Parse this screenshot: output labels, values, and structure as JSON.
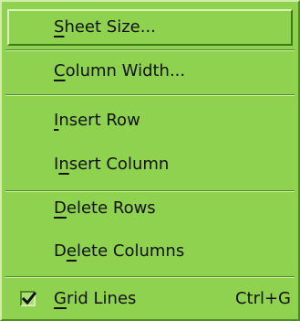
{
  "menu": {
    "items": [
      {
        "pre": "",
        "key": "S",
        "post": "heet Size...",
        "shortcut": ""
      },
      {
        "pre": "",
        "key": "C",
        "post": "olumn Width...",
        "shortcut": ""
      },
      {
        "pre": "",
        "key": "I",
        "post": "nsert Row",
        "shortcut": ""
      },
      {
        "pre": "I",
        "key": "n",
        "post": "sert Column",
        "shortcut": ""
      },
      {
        "pre": "",
        "key": "D",
        "post": "elete Rows",
        "shortcut": ""
      },
      {
        "pre": "D",
        "key": "e",
        "post": "lete Columns",
        "shortcut": ""
      },
      {
        "pre": "",
        "key": "G",
        "post": "rid Lines",
        "shortcut": "Ctrl+G",
        "checked": true
      }
    ]
  },
  "colors": {
    "menu_bg": "#8ed250",
    "text": "#111111"
  }
}
